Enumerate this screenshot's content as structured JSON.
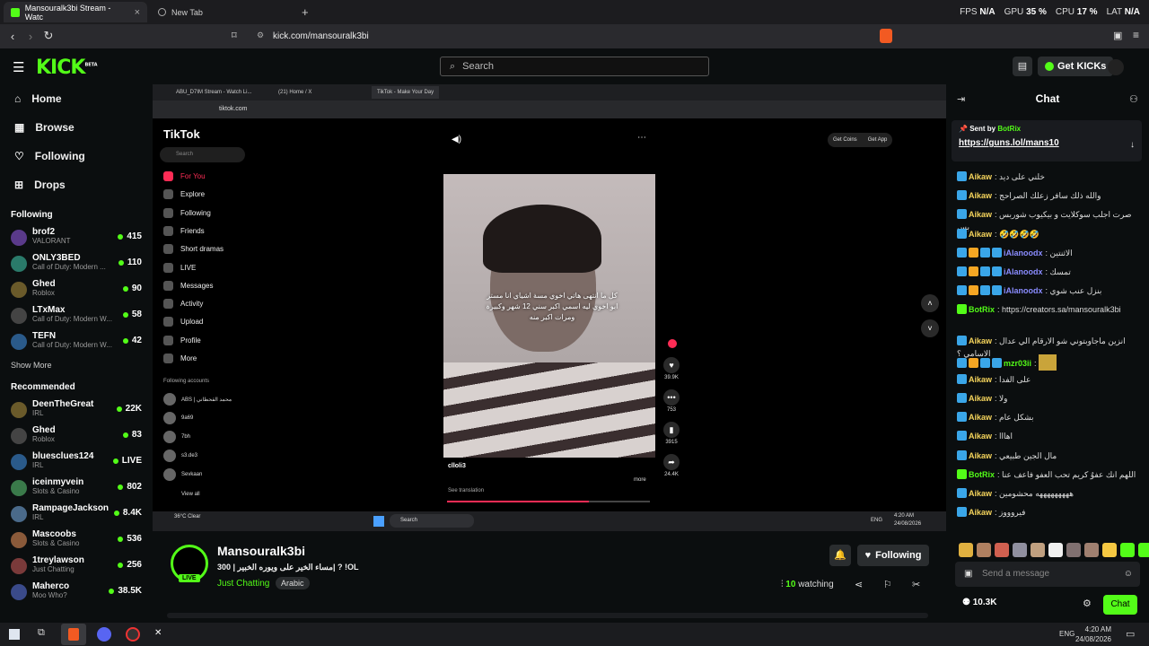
{
  "browser": {
    "tabs": [
      {
        "label": "Mansouralk3bi Stream - Watc",
        "active": true
      },
      {
        "label": "New Tab",
        "active": false
      }
    ],
    "new_tab_icon": "plus-icon",
    "url": "kick.com/mansouralk3bi",
    "stats": {
      "fps_label": "FPS",
      "fps": "N/A",
      "gpu_label": "GPU",
      "gpu": "35 %",
      "cpu_label": "CPU",
      "cpu": "17 %",
      "lat_label": "LAT",
      "lat": "N/A"
    }
  },
  "kick": {
    "logo": "KICK",
    "logo_badge": "BETA",
    "search_placeholder": "Search",
    "get_kicks": "Get KICKs",
    "accent": "#53fc18"
  },
  "sidebar": {
    "nav": [
      {
        "label": "Home",
        "icon": "home-icon"
      },
      {
        "label": "Browse",
        "icon": "browse-icon"
      },
      {
        "label": "Following",
        "icon": "heart-icon"
      },
      {
        "label": "Drops",
        "icon": "drops-icon"
      }
    ],
    "following_header": "Following",
    "following": [
      {
        "name": "brof2",
        "category": "VALORANT",
        "viewers": "415"
      },
      {
        "name": "ONLY3BED",
        "category": "Call of Duty: Modern ...",
        "viewers": "110"
      },
      {
        "name": "Ghed",
        "category": "Roblox",
        "viewers": "90"
      },
      {
        "name": "LTxMax",
        "category": "Call of Duty: Modern W...",
        "viewers": "58"
      },
      {
        "name": "TEFN",
        "category": "Call of Duty: Modern W...",
        "viewers": "42"
      }
    ],
    "show_more": "Show More",
    "recommended_header": "Recommended",
    "recommended": [
      {
        "name": "DeenTheGreat",
        "category": "IRL",
        "viewers": "22K"
      },
      {
        "name": "Ghed",
        "category": "Roblox",
        "viewers": "83"
      },
      {
        "name": "bluesclues124",
        "category": "IRL",
        "viewers": "LIVE"
      },
      {
        "name": "iceinmyvein",
        "category": "Slots & Casino",
        "viewers": "802"
      },
      {
        "name": "RampageJackson",
        "category": "IRL",
        "viewers": "8.4K"
      },
      {
        "name": "Mascoobs",
        "category": "Slots & Casino",
        "viewers": "536"
      },
      {
        "name": "1treylawson",
        "category": "Just Chatting",
        "viewers": "256"
      },
      {
        "name": "Maherco",
        "category": "Moo Who?",
        "viewers": "38.5K"
      }
    ]
  },
  "video": {
    "inner_tabs": [
      "ABU_D7IM Stream - Watch Li...",
      "(21) Home / X",
      "TikTok - Make Your Day"
    ],
    "inner_url": "tiktok.com",
    "tiktok_logo": "TikTok",
    "tiktok_search": "Search",
    "tiktok_nav": [
      "For You",
      "Explore",
      "Following",
      "Friends",
      "Short dramas",
      "LIVE",
      "Messages",
      "Activity",
      "Upload",
      "Profile",
      "More"
    ],
    "following_accounts": "Following accounts",
    "accounts": [
      "ABS | محمد القحطاني",
      "9a69",
      "7bh",
      "s3.de3",
      "Sevkaan"
    ],
    "view_all": "View all",
    "get_coins": "Get Coins",
    "get_app": "Get App",
    "clip_caption": "كل ما انتهى هاتي اخوي مسة اشياي انا مستر ابو اخوي ليه اسمي اكبر سني 12 شهر وكبيرة ومرات اكبر منه",
    "clip_user": "clloli3",
    "see_translation": "See translation",
    "more": "more",
    "actions": [
      {
        "icon": "heart-icon",
        "count": "39.9K"
      },
      {
        "icon": "comment-icon",
        "count": "753"
      },
      {
        "icon": "bookmark-icon",
        "count": "3915"
      },
      {
        "icon": "share-icon",
        "count": "24.4K"
      }
    ],
    "weather": "36°C Clear",
    "inner_search": "Search",
    "inner_time": "4:20 AM",
    "inner_date": "24/08/2026",
    "inner_lang": "ENG"
  },
  "stream": {
    "channel": "Mansouralk3bi",
    "title": "مساء الخير على ويوره الخبير | 300|  ? !OL",
    "category": "Just Chatting",
    "tag": "Arabic",
    "live": "LIVE",
    "watching_count": "10",
    "watching_label": "watching",
    "follow_label": "Following"
  },
  "chat": {
    "title": "Chat",
    "pinned": {
      "sent_by": "Sent by",
      "user": "BotRix",
      "link": "https://guns.lol/mans10"
    },
    "messages": [
      {
        "user": "Aikaw",
        "color": "#f5d45c",
        "text": "خلني على ديد"
      },
      {
        "user": "Aikaw",
        "color": "#f5d45c",
        "text": "والله ذلك سافر زعلك الصراحج"
      },
      {
        "user": "Aikaw",
        "color": "#f5d45c",
        "text": "صرت اجلب سوكلايت و بيكيوب شوربس بس"
      },
      {
        "user": "Aikaw",
        "color": "#f5d45c",
        "text": "🤣🤣🤣🤣"
      },
      {
        "user": "iAlanoodx",
        "color": "#8a8cff",
        "text": "الاثنتين"
      },
      {
        "user": "iAlanoodx",
        "color": "#8a8cff",
        "text": "تمسك"
      },
      {
        "user": "iAlanoodx",
        "color": "#8a8cff",
        "text": "بنزل عنب شوي"
      },
      {
        "user": "BotRix",
        "color": "#53fc18",
        "text": "https://creators.sa/mansouralk3bi"
      },
      {
        "user": "Aikaw",
        "color": "#f5d45c",
        "text": "انزين ماجاوبتوني شو الارقام الي عدال الاسامي ؟"
      },
      {
        "user": "mzr03ii",
        "color": "#53fc18",
        "text": ""
      },
      {
        "user": "Aikaw",
        "color": "#f5d45c",
        "text": "على الفدا"
      },
      {
        "user": "Aikaw",
        "color": "#f5d45c",
        "text": "ولا"
      },
      {
        "user": "Aikaw",
        "color": "#f5d45c",
        "text": "بشكل عام"
      },
      {
        "user": "Aikaw",
        "color": "#f5d45c",
        "text": "اهااا"
      },
      {
        "user": "Aikaw",
        "color": "#f5d45c",
        "text": "مال الجين طبيعي"
      },
      {
        "user": "BotRix",
        "color": "#53fc18",
        "text": "اللهم انك عفوٌ كريم تحب العفو فاعف عنا"
      },
      {
        "user": "Aikaw",
        "color": "#f5d45c",
        "text": "هههههههههه محشومين"
      },
      {
        "user": "Aikaw",
        "color": "#f5d45c",
        "text": "فيروووز"
      }
    ],
    "input_placeholder": "Send a message",
    "kicks": "10.3K",
    "chat_button": "Chat"
  },
  "os": {
    "time": "4:20 AM",
    "date": "24/08/2026",
    "lang": "ENG"
  }
}
